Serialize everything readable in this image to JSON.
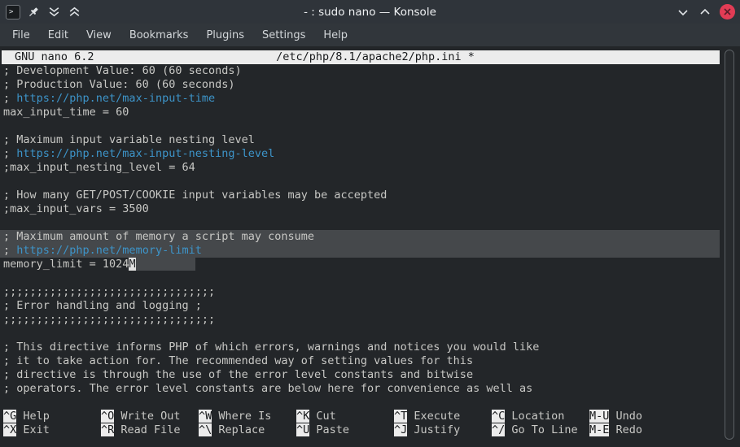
{
  "window": {
    "title": "- : sudo nano — Konsole",
    "titlebar_icons": [
      "konsole-app-icon",
      "pin-icon",
      "keep-below-icon",
      "keep-above-icon"
    ],
    "control_icons": [
      "minimize-icon",
      "maximize-icon",
      "close-icon"
    ],
    "app_prompt_glyph": ">"
  },
  "menubar": {
    "items": [
      "File",
      "Edit",
      "View",
      "Bookmarks",
      "Plugins",
      "Settings",
      "Help"
    ]
  },
  "nano_header": {
    "version": "GNU nano 6.2",
    "path": "/etc/php/8.1/apache2/php.ini *"
  },
  "editor": {
    "lines": [
      {
        "seg": [
          {
            "t": "; Development Value: 60 (60 seconds)"
          }
        ]
      },
      {
        "seg": [
          {
            "t": "; Production Value: 60 (60 seconds)"
          }
        ]
      },
      {
        "seg": [
          {
            "t": "; "
          },
          {
            "t": "https://php.net/max-input-time",
            "s": "url"
          }
        ]
      },
      {
        "seg": [
          {
            "t": "max_input_time = 60"
          }
        ]
      },
      {
        "seg": []
      },
      {
        "seg": [
          {
            "t": "; Maximum input variable nesting level"
          }
        ]
      },
      {
        "seg": [
          {
            "t": "; "
          },
          {
            "t": "https://php.net/max-input-nesting-level",
            "s": "url"
          }
        ]
      },
      {
        "seg": [
          {
            "t": ";max_input_nesting_level = 64"
          }
        ]
      },
      {
        "seg": []
      },
      {
        "seg": [
          {
            "t": "; How many GET/POST/COOKIE input variables may be accepted"
          }
        ]
      },
      {
        "seg": [
          {
            "t": ";max_input_vars = 3500"
          }
        ]
      },
      {
        "seg": []
      },
      {
        "hl": true,
        "seg": [
          {
            "t": "; Maximum amount of memory a script may consume"
          }
        ]
      },
      {
        "hl": true,
        "seg": [
          {
            "t": "; "
          },
          {
            "t": "https://php.net/memory-limit",
            "s": "url"
          }
        ]
      },
      {
        "seg": [
          {
            "t": "memory_limit = 1024"
          },
          {
            "t": "M",
            "s": "cursor"
          },
          {
            "t": "         ",
            "s": "tail"
          }
        ]
      },
      {
        "seg": []
      },
      {
        "seg": [
          {
            "t": ";;;;;;;;;;;;;;;;;;;;;;;;;;;;;;;;"
          }
        ]
      },
      {
        "seg": [
          {
            "t": "; Error handling and logging ;"
          }
        ]
      },
      {
        "seg": [
          {
            "t": ";;;;;;;;;;;;;;;;;;;;;;;;;;;;;;;;"
          }
        ]
      },
      {
        "seg": []
      },
      {
        "seg": [
          {
            "t": "; This directive informs PHP of which errors, warnings and notices you would like"
          }
        ]
      },
      {
        "seg": [
          {
            "t": "; it to take action for. The recommended way of setting values for this"
          }
        ]
      },
      {
        "seg": [
          {
            "t": "; directive is through the use of the error level constants and bitwise"
          }
        ]
      },
      {
        "seg": [
          {
            "t": "; operators. The error level constants are below here for convenience as well as"
          }
        ]
      }
    ]
  },
  "shortcuts": {
    "rows": [
      [
        {
          "key": "^G",
          "label": "Help"
        },
        {
          "key": "^O",
          "label": "Write Out"
        },
        {
          "key": "^W",
          "label": "Where Is"
        },
        {
          "key": "^K",
          "label": "Cut"
        },
        {
          "key": "^T",
          "label": "Execute"
        },
        {
          "key": "^C",
          "label": "Location"
        },
        {
          "key": "M-U",
          "label": "Undo"
        }
      ],
      [
        {
          "key": "^X",
          "label": "Exit"
        },
        {
          "key": "^R",
          "label": "Read File"
        },
        {
          "key": "^\\",
          "label": "Replace"
        },
        {
          "key": "^U",
          "label": "Paste"
        },
        {
          "key": "^J",
          "label": "Justify"
        },
        {
          "key": "^/",
          "label": "Go To Line"
        },
        {
          "key": "M-E",
          "label": "Redo"
        }
      ]
    ]
  },
  "colors": {
    "terminal_bg": "#232629",
    "titlebar_bg": "#2f343a",
    "menubar_bg": "#31363b",
    "text": "#c8c8c5",
    "url_blue": "#3d94c9",
    "selection_bg": "#45484b",
    "cursor_bg": "#e0e0e0",
    "nano_bar_bg": "#ececec",
    "close_button_red": "#e23c55"
  }
}
